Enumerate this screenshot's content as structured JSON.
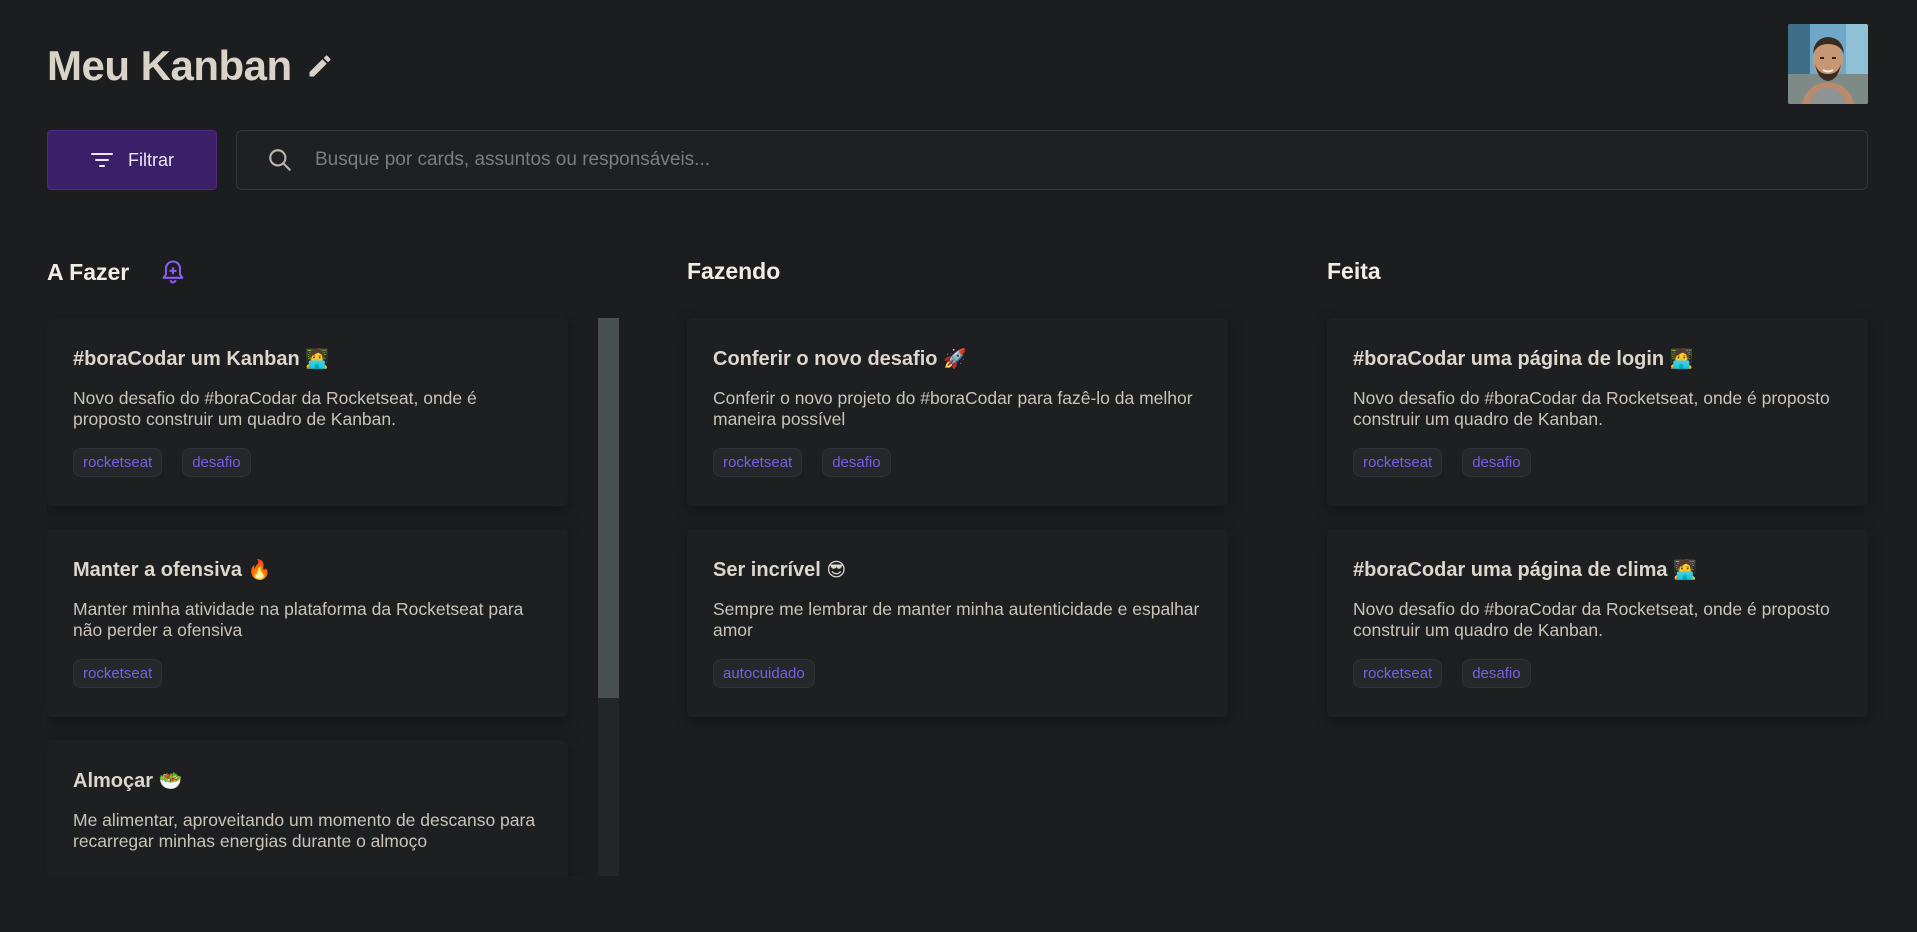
{
  "header": {
    "title": "Meu Kanban"
  },
  "toolbar": {
    "filter_label": "Filtrar",
    "search_placeholder": "Busque por cards, assuntos ou responsáveis..."
  },
  "columns": [
    {
      "title": "A Fazer",
      "cards": [
        {
          "title": "#boraCodar um Kanban",
          "emoji": "🧑‍💻",
          "description": "Novo desafio do #boraCodar da Rocketseat, onde é proposto construir um quadro de Kanban.",
          "tags": [
            "rocketseat",
            "desafio"
          ]
        },
        {
          "title": "Manter a ofensiva",
          "emoji": "🔥",
          "description": "Manter minha atividade na plataforma da Rocketseat para não perder a ofensiva",
          "tags": [
            "rocketseat"
          ]
        },
        {
          "title": "Almoçar",
          "emoji": "🥗",
          "description": "Me alimentar, aproveitando um momento de descanso para recarregar minhas energias durante o almoço",
          "tags": []
        }
      ]
    },
    {
      "title": "Fazendo",
      "cards": [
        {
          "title": "Conferir o novo desafio",
          "emoji": "🚀",
          "description": "Conferir o novo projeto do #boraCodar para fazê-lo da melhor maneira possível",
          "tags": [
            "rocketseat",
            "desafio"
          ]
        },
        {
          "title": "Ser incrível",
          "emoji": "😎",
          "description": "Sempre me lembrar de manter minha autenticidade e espalhar amor",
          "tags": [
            "autocuidado"
          ]
        }
      ]
    },
    {
      "title": "Feita",
      "cards": [
        {
          "title": "#boraCodar uma página de login",
          "emoji": "🧑‍💻",
          "description": "Novo desafio do #boraCodar da Rocketseat, onde é proposto construir um quadro de Kanban.",
          "tags": [
            "rocketseat",
            "desafio"
          ]
        },
        {
          "title": "#boraCodar uma página de clima",
          "emoji": "🧑‍💻",
          "description": "Novo desafio do #boraCodar da Rocketseat, onde é proposto construir um quadro de Kanban.",
          "tags": [
            "rocketseat",
            "desafio"
          ]
        }
      ]
    }
  ],
  "colors": {
    "background": "#1b1d1f",
    "accent": "#3b1f68",
    "tag_text": "#7a5fe0",
    "bell": "#8a5cf0"
  },
  "icons": {
    "edit": "pencil-icon",
    "filter": "filter-icon",
    "search": "search-icon",
    "bell": "bell-plus-icon",
    "avatar": "user-avatar"
  }
}
